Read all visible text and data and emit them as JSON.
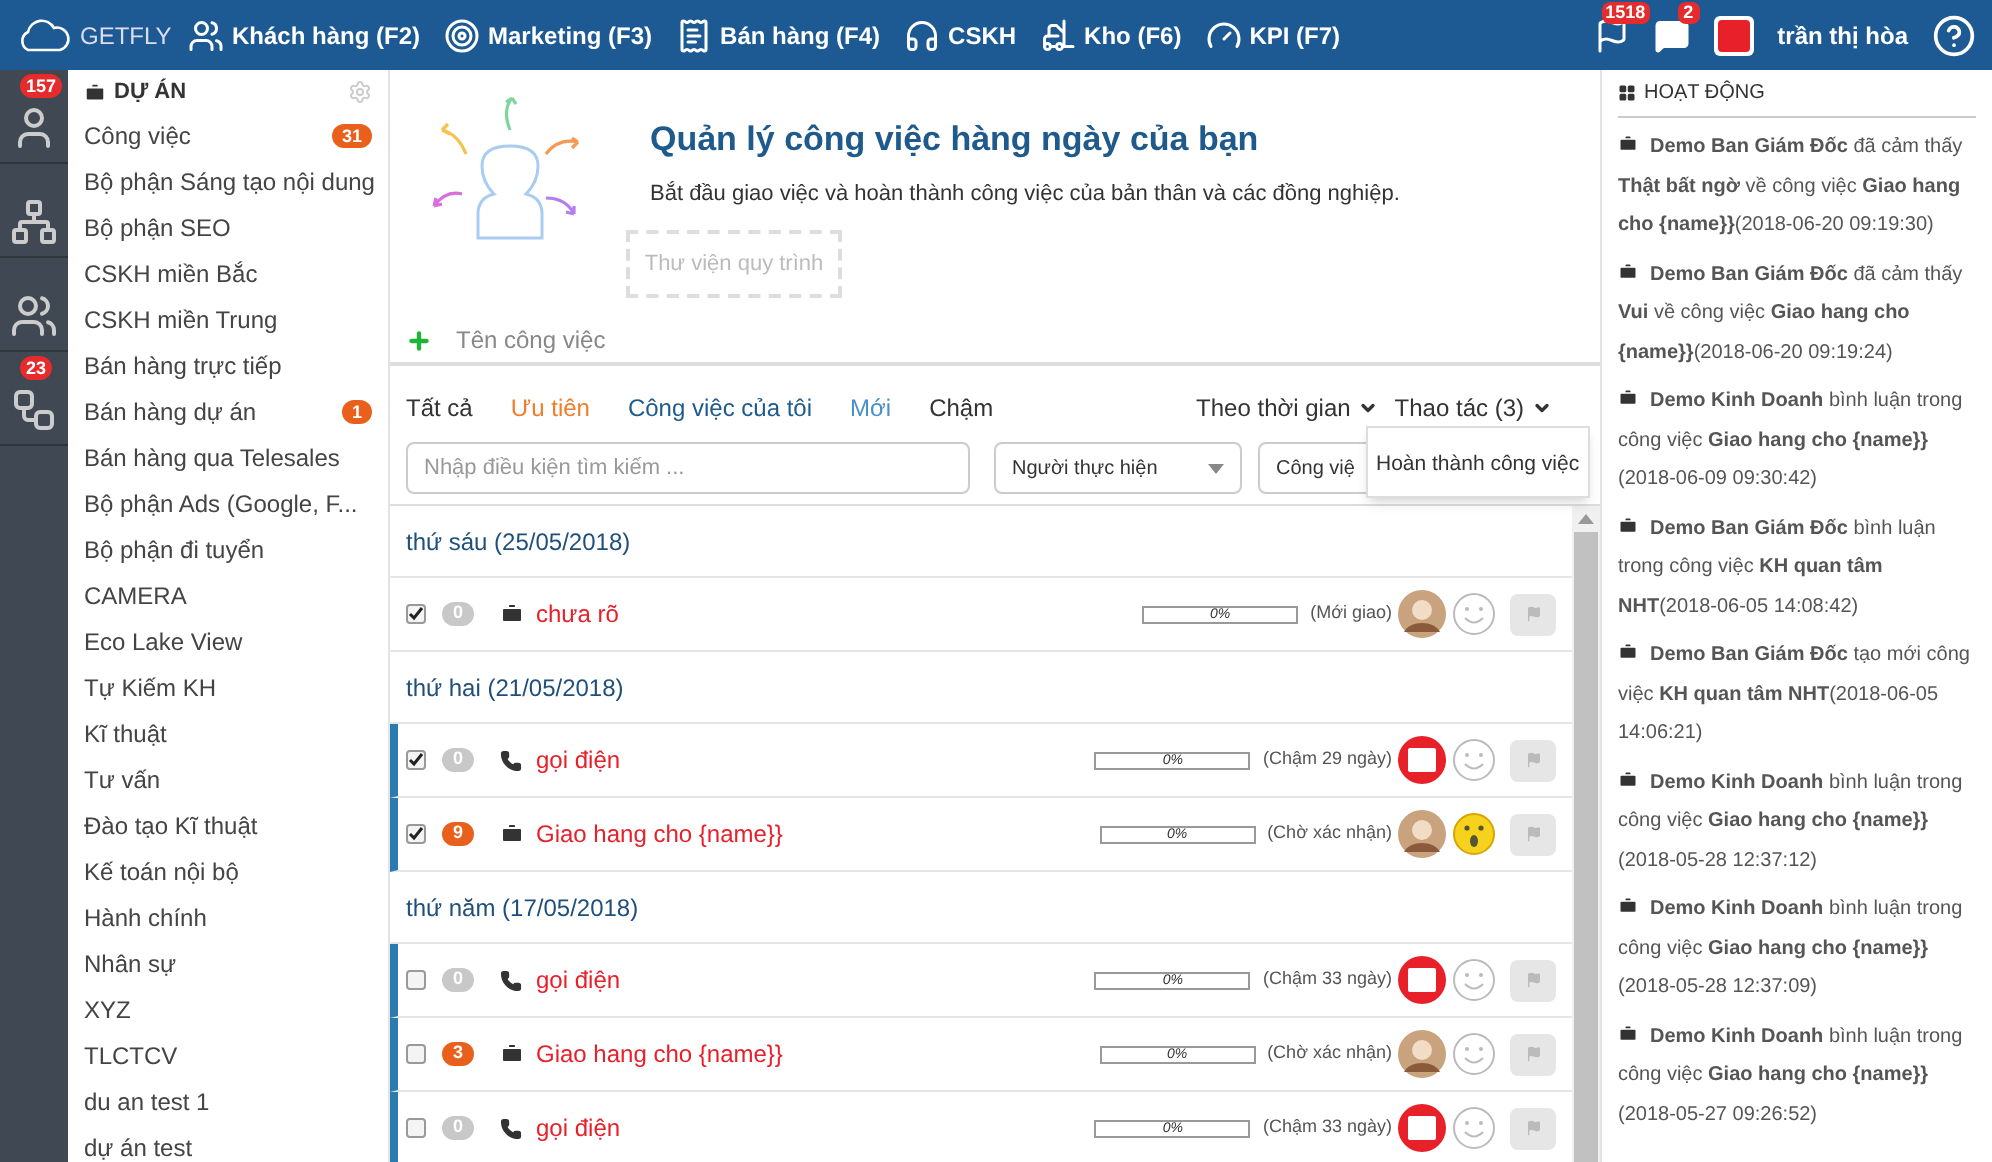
{
  "topbar": {
    "logo": "GETFLY",
    "nav": [
      {
        "kind": "customers",
        "label": "Khách hàng (F2)"
      },
      {
        "kind": "marketing",
        "label": "Marketing (F3)"
      },
      {
        "kind": "sales",
        "label": "Bán hàng (F4)"
      },
      {
        "kind": "support",
        "label": "CSKH"
      },
      {
        "kind": "warehouse",
        "label": "Kho (F6)"
      },
      {
        "kind": "kpi",
        "label": "KPI (F7)"
      }
    ],
    "notifications": "1518",
    "messages": "2",
    "user": "trần thị hòa"
  },
  "rail": [
    {
      "kind": "user",
      "badge": "157"
    },
    {
      "kind": "org"
    },
    {
      "kind": "people"
    },
    {
      "kind": "flow",
      "badge": "23"
    }
  ],
  "sidebar": {
    "title": "DỰ ÁN",
    "items": [
      {
        "label": "Công việc",
        "badge": "31"
      },
      {
        "label": "Bộ phận Sáng tạo nội dung"
      },
      {
        "label": "Bộ phận SEO"
      },
      {
        "label": "CSKH miền Bắc"
      },
      {
        "label": "CSKH miền Trung"
      },
      {
        "label": "Bán hàng trực tiếp"
      },
      {
        "label": "Bán hàng dự án",
        "badge": "1"
      },
      {
        "label": "Bán hàng qua Telesales"
      },
      {
        "label": "Bộ phận Ads (Google, F..."
      },
      {
        "label": "Bộ phận đi tuyển"
      },
      {
        "label": "CAMERA"
      },
      {
        "label": "Eco Lake View"
      },
      {
        "label": "Tự Kiếm KH"
      },
      {
        "label": "Kĩ thuật"
      },
      {
        "label": "Tư vấn"
      },
      {
        "label": "Đào tạo Kĩ thuật"
      },
      {
        "label": "Kế toán nội bộ"
      },
      {
        "label": "Hành chính"
      },
      {
        "label": "Nhân sự"
      },
      {
        "label": "XYZ"
      },
      {
        "label": "TLCTCV"
      },
      {
        "label": "du an test 1"
      },
      {
        "label": "dự án test"
      }
    ]
  },
  "intro": {
    "title": "Quản lý công việc hàng ngày của bạn",
    "subtitle": "Bắt đầu giao việc và hoàn thành công việc của bản thân và các đồng nghiệp.",
    "library_button": "Thư viện quy trình",
    "new_task_placeholder": "Tên công việc"
  },
  "filters": {
    "tabs": [
      {
        "label": "Tất cả",
        "color": "#333333"
      },
      {
        "label": "Ưu tiên",
        "color": "#f07d2a"
      },
      {
        "label": "Công việc của tôi",
        "color": "#1f5a8c"
      },
      {
        "label": "Mới",
        "color": "#4a8fc8"
      },
      {
        "label": "Chậm",
        "color": "#333333"
      }
    ],
    "sort": "Theo thời gian",
    "actions": "Thao tác (3)",
    "search_placeholder": "Nhập điều kiện tìm kiếm ...",
    "assignee": "Người thực hiện",
    "type": "Công việ",
    "menu_item": "Hoàn thành công việc"
  },
  "groups": [
    {
      "date": "thứ sáu (25/05/2018)",
      "tasks": [
        {
          "checked": true,
          "count": "0",
          "hot": false,
          "kind": "task",
          "title": "chưa rõ",
          "level": 0,
          "reading": "0%",
          "status": "(Mới giao)",
          "assignee": {
            "kind": "photo"
          },
          "mood": {
            "kind": "smile"
          },
          "accent": false
        }
      ]
    },
    {
      "date": "thứ hai (21/05/2018)",
      "tasks": [
        {
          "checked": true,
          "count": "0",
          "hot": false,
          "kind": "call",
          "title": "gọi điện",
          "level": 0,
          "reading": "0%",
          "status": "(Chậm 29 ngày)",
          "assignee": {
            "kind": "flag"
          },
          "mood": {
            "kind": "smile"
          },
          "accent": true
        },
        {
          "checked": true,
          "count": "9",
          "hot": true,
          "kind": "task",
          "title": "Giao hang cho {name}}",
          "level": 0,
          "reading": "0%",
          "status": "(Chờ xác nhận)",
          "assignee": {
            "kind": "photo"
          },
          "mood": {
            "kind": "surprised"
          },
          "accent": true
        }
      ]
    },
    {
      "date": "thứ năm (17/05/2018)",
      "tasks": [
        {
          "checked": false,
          "count": "0",
          "hot": false,
          "kind": "call",
          "title": "gọi điện",
          "level": 0,
          "reading": "0%",
          "status": "(Chậm 33 ngày)",
          "assignee": {
            "kind": "flag"
          },
          "mood": {
            "kind": "smile"
          },
          "accent": true
        },
        {
          "checked": false,
          "count": "3",
          "hot": true,
          "kind": "task",
          "title": "Giao hang cho {name}}",
          "level": 0,
          "reading": "0%",
          "status": "(Chờ xác nhận)",
          "assignee": {
            "kind": "photo"
          },
          "mood": {
            "kind": "smile"
          },
          "accent": true
        },
        {
          "checked": false,
          "count": "0",
          "hot": false,
          "kind": "call",
          "title": "gọi điện",
          "level": 0,
          "reading": "0%",
          "status": "(Chậm 33 ngày)",
          "assignee": {
            "kind": "flag"
          },
          "mood": {
            "kind": "smile"
          },
          "accent": true
        }
      ]
    }
  ],
  "activity": {
    "title": "HOẠT ĐỘNG",
    "items": [
      "**Demo Ban Giám Đốc** đã cảm thấy **Thật bất ngờ** về công việc **Giao hang cho {name}}**(2018-06-20 09:19:30)",
      "**Demo Ban Giám Đốc** đã cảm thấy **Vui** về công việc **Giao hang cho {name}}**(2018-06-20 09:19:24)",
      "**Demo Kinh Doanh** bình luận trong công việc **Giao hang cho {name}}**(2018-06-09 09:30:42)",
      "**Demo Ban Giám Đốc** bình luận trong công việc **KH quan tâm NHT**(2018-06-05 14:08:42)",
      "**Demo Ban Giám Đốc** tạo mới công việc **KH quan tâm NHT**(2018-06-05 14:06:21)",
      "**Demo Kinh Doanh** bình luận trong công việc **Giao hang cho {name}}**(2018-05-28 12:37:12)",
      "**Demo Kinh Doanh** bình luận trong công việc **Giao hang cho {name}}**(2018-05-28 12:37:09)",
      "**Demo Kinh Doanh** bình luận trong công việc **Giao hang cho {name}}**(2018-05-27 09:26:52)"
    ]
  }
}
